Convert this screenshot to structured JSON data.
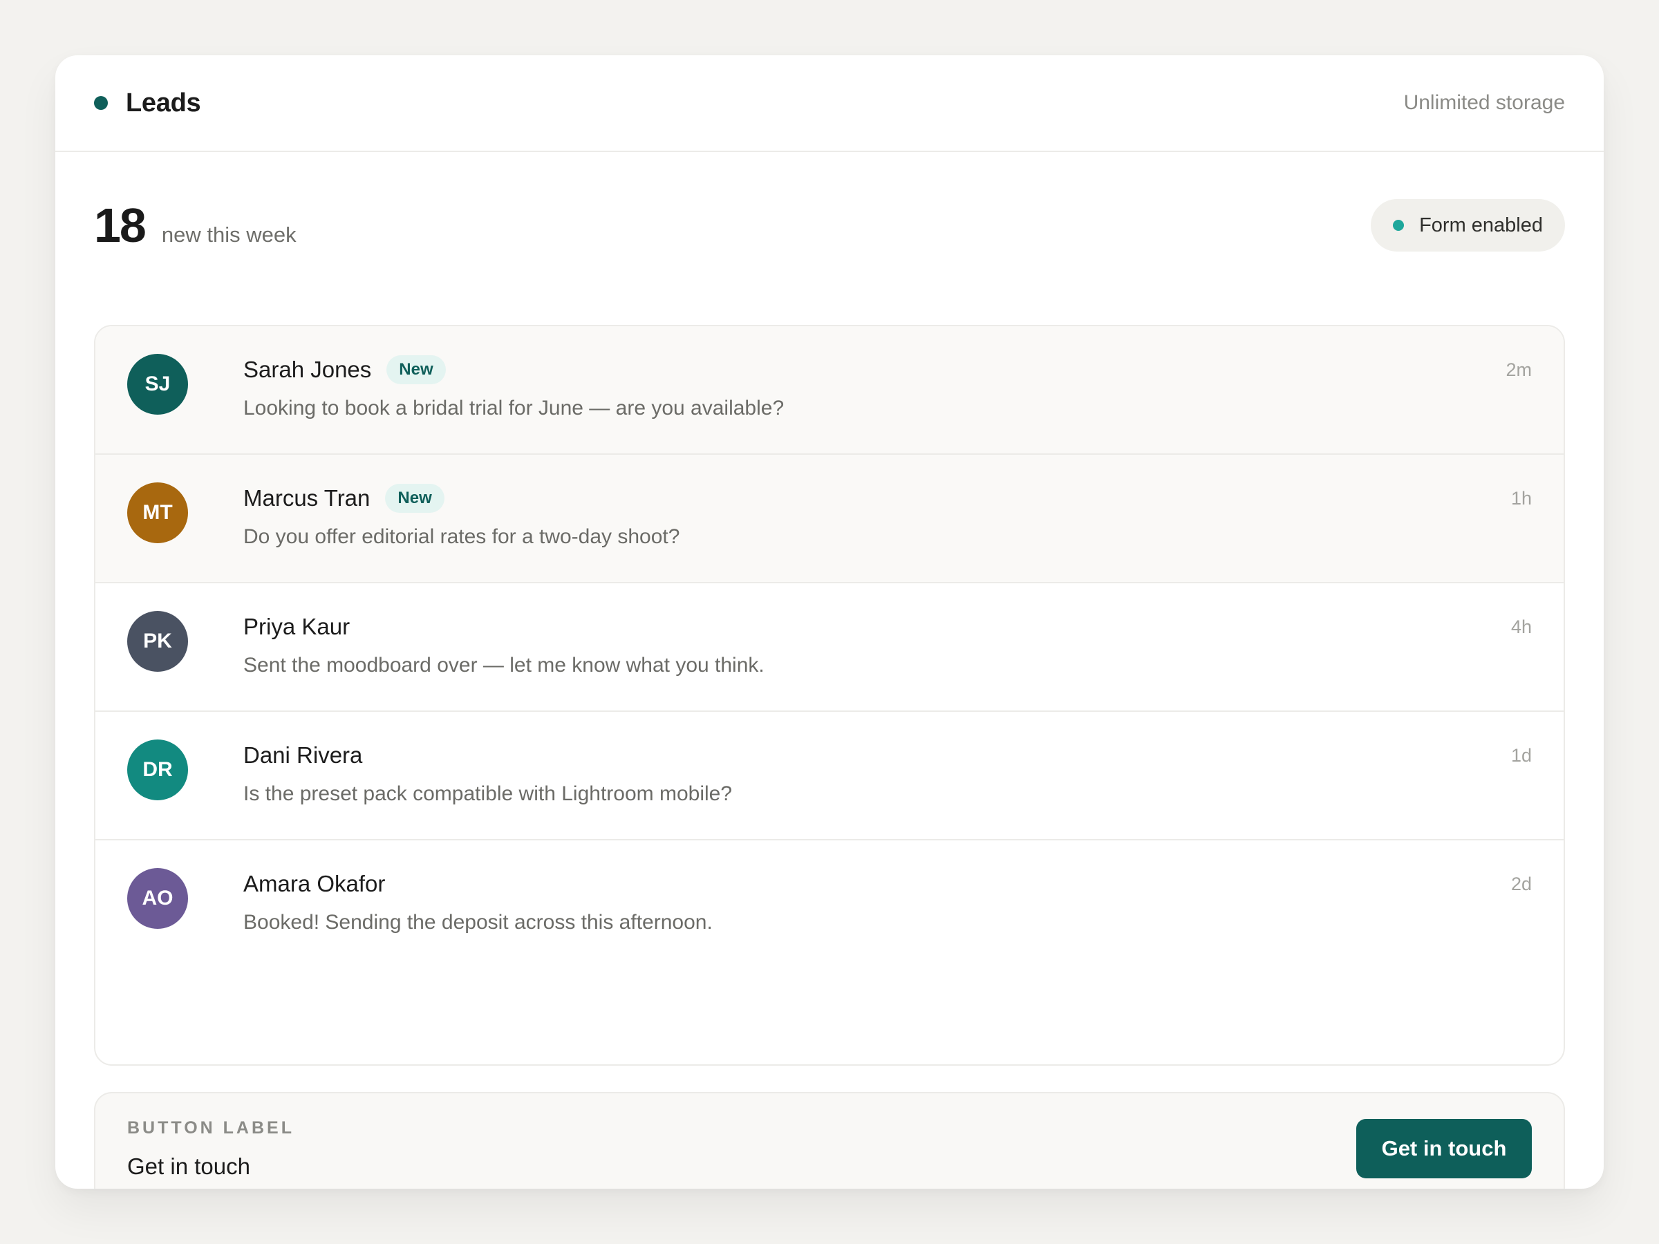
{
  "header": {
    "title": "Leads",
    "storage_label": "Unlimited storage"
  },
  "summary": {
    "count": "18",
    "caption": "new this week",
    "form_status": "Form enabled"
  },
  "leads": [
    {
      "initials": "SJ",
      "name": "Sarah Jones",
      "badge": "New",
      "message": "Looking to book a bridal trial for June — are you available?",
      "time": "2m",
      "avatar_color": "#0f5f5a"
    },
    {
      "initials": "MT",
      "name": "Marcus Tran",
      "badge": "New",
      "message": "Do you offer editorial rates for a two-day shoot?",
      "time": "1h",
      "avatar_color": "#a8680f"
    },
    {
      "initials": "PK",
      "name": "Priya Kaur",
      "badge": "",
      "message": "Sent the moodboard over — let me know what you think.",
      "time": "4h",
      "avatar_color": "#4a5262"
    },
    {
      "initials": "DR",
      "name": "Dani Rivera",
      "badge": "",
      "message": "Is the preset pack compatible with Lightroom mobile?",
      "time": "1d",
      "avatar_color": "#128a80"
    },
    {
      "initials": "AO",
      "name": "Amara Okafor",
      "badge": "",
      "message": "Booked! Sending the deposit across this afternoon.",
      "time": "2d",
      "avatar_color": "#6c5a96"
    }
  ],
  "cta": {
    "caption": "Button label",
    "value": "Get in touch",
    "button_label": "Get in touch"
  },
  "colors": {
    "accent": "#0e5f5a",
    "form_dot": "#1ea79b",
    "badge_bg": "#e4f4f1"
  }
}
